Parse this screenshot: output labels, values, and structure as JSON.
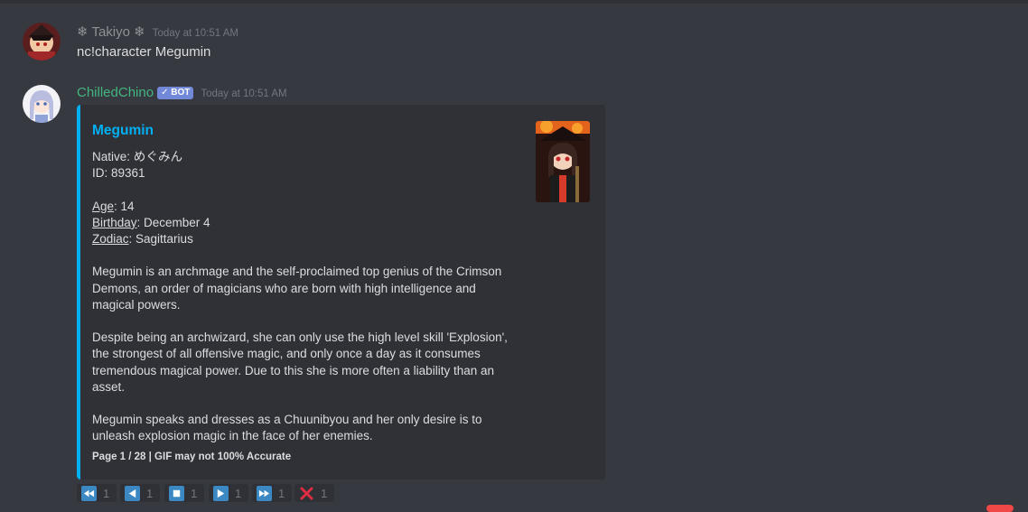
{
  "messages": [
    {
      "username": "❄ Takiyo ❄",
      "timestamp": "Today at 10:51 AM",
      "content": "nc!character Megumin"
    },
    {
      "username": "ChilledChino",
      "bot_tag": "✓ BOT",
      "timestamp": "Today at 10:51 AM",
      "embed": {
        "title": "Megumin",
        "native_label": "Native",
        "native_value": ": めぐみん",
        "id_line": "ID: 89361",
        "age_label": "Age",
        "age_value": ": 14",
        "birthday_label": "Birthday",
        "birthday_value": ": December 4",
        "zodiac_label": "Zodiac",
        "zodiac_value": ": Sagittarius",
        "paragraphs": [
          "Megumin is an archmage and the self-proclaimed top genius of the Crimson Demons, an order of magicians who are born with high intelligence and magical powers.",
          "Despite being an archwizard, she can only use the high level skill 'Explosion', the strongest of all offensive magic, and only once a day as it consumes tremendous magical power. Due to this she is more often a liability than an asset.",
          "Megumin speaks and dresses as a Chuunibyou and her only desire is to unleash explosion magic in the face of her enemies."
        ],
        "footer": "Page 1 / 28 | GIF may not 100% Accurate",
        "accent_color": "#00b0f4"
      },
      "reactions": [
        {
          "icon": "rewind-icon",
          "count": "1"
        },
        {
          "icon": "previous-icon",
          "count": "1"
        },
        {
          "icon": "stop-icon",
          "count": "1"
        },
        {
          "icon": "next-icon",
          "count": "1"
        },
        {
          "icon": "fast-forward-icon",
          "count": "1"
        },
        {
          "icon": "cross-icon",
          "count": "1"
        }
      ]
    }
  ],
  "colors": {
    "background": "#36393f",
    "embed_background": "#2f3136",
    "bot_name": "#43b581",
    "bot_tag": "#7289da",
    "reaction_blue": "#3b88c3",
    "reaction_red": "#dd2e44"
  }
}
